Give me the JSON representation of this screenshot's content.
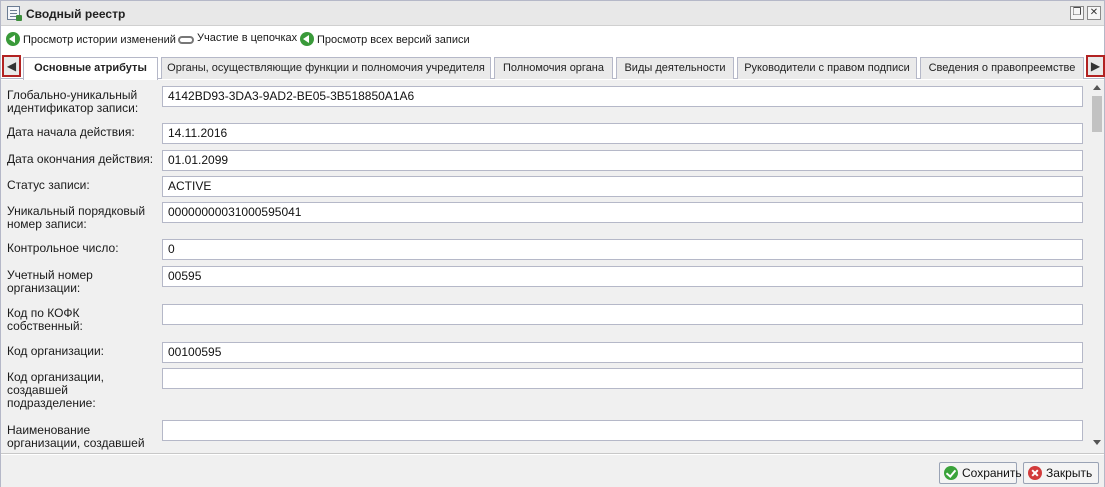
{
  "window": {
    "title": "Сводный реестр",
    "restore_icon": "restore-icon",
    "close_icon": "close-icon"
  },
  "toolbar": {
    "history_label": "Просмотр истории изменений",
    "chains_label": "Участие в цепочках",
    "versions_label": "Просмотр всех версий записи"
  },
  "tabs": [
    {
      "label": "Основные атрибуты",
      "active": true
    },
    {
      "label": "Органы, осуществляющие функции и полномочия учредителя",
      "active": false
    },
    {
      "label": "Полномочия органа",
      "active": false
    },
    {
      "label": "Виды деятельности",
      "active": false
    },
    {
      "label": "Руководители с правом подписи",
      "active": false
    },
    {
      "label": "Сведения о правопреемстве",
      "active": false
    }
  ],
  "form": {
    "fields": [
      {
        "label": "Глобально-уникальный идентификатор записи:",
        "value": "4142BD93-3DA3-9AD2-BE05-3B518850A1A6"
      },
      {
        "label": "Дата начала действия:",
        "value": "14.11.2016"
      },
      {
        "label": "Дата окончания действия:",
        "value": "01.01.2099"
      },
      {
        "label": "Статус записи:",
        "value": "ACTIVE"
      },
      {
        "label": "Уникальный порядковый номер записи:",
        "value": "00000000031000595041"
      },
      {
        "label": "Контрольное число:",
        "value": "0"
      },
      {
        "label": "Учетный номер организации:",
        "value": "00595"
      },
      {
        "label": "Код по КОФК собственный:",
        "value": ""
      },
      {
        "label": "Код организации:",
        "value": "00100595"
      },
      {
        "label": "Код организации, создавшей подразделение:",
        "value": ""
      },
      {
        "label": "Наименование организации, создавшей",
        "value": ""
      }
    ]
  },
  "footer": {
    "save_label": "Сохранить",
    "close_label": "Закрыть"
  },
  "colors": {
    "tab_scroll_border": "#b22222",
    "form_background": "#f0f0f0",
    "input_border": "#b5b8c8"
  }
}
